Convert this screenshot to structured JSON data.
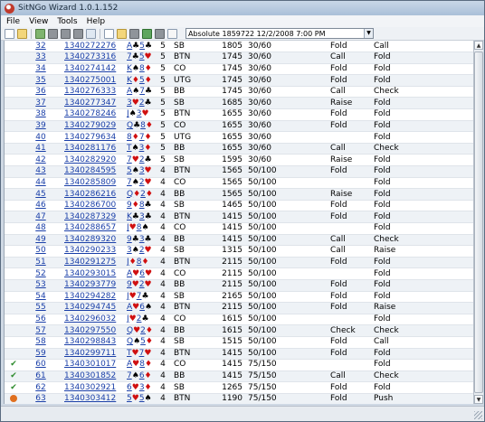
{
  "window": {
    "title": "SitNGo Wizard 1.0.1.152"
  },
  "menu": {
    "file": "File",
    "view": "View",
    "tools": "Tools",
    "help": "Help"
  },
  "toolbar": {
    "session_value": "Absolute 1859722 12/2/2008 7:00 PM"
  },
  "colors": {
    "link": "#1a3fa8",
    "red_suit": "#d01010",
    "status_green": "#2e8b2e",
    "status_orange": "#e07020"
  },
  "rows": [
    {
      "status": "",
      "idx": "32",
      "hand": "1340272276",
      "c1": "A",
      "s1": "♣",
      "c2": "5",
      "s2": "♣",
      "pl": "5",
      "pos": "SB",
      "chips": "1805",
      "blinds": "30/60",
      "a1": "",
      "a2": "Fold",
      "a3": "Call"
    },
    {
      "status": "",
      "idx": "33",
      "hand": "1340273316",
      "c1": "7",
      "s1": "♣",
      "c2": "5",
      "s2": "♥",
      "pl": "5",
      "pos": "BTN",
      "chips": "1745",
      "blinds": "30/60",
      "a1": "",
      "a2": "Call",
      "a3": "Fold"
    },
    {
      "status": "",
      "idx": "34",
      "hand": "1340274142",
      "c1": "K",
      "s1": "♠",
      "c2": "8",
      "s2": "♦",
      "pl": "5",
      "pos": "CO",
      "chips": "1745",
      "blinds": "30/60",
      "a1": "",
      "a2": "Fold",
      "a3": "Fold"
    },
    {
      "status": "",
      "idx": "35",
      "hand": "1340275001",
      "c1": "K",
      "s1": "♦",
      "c2": "5",
      "s2": "♦",
      "pl": "5",
      "pos": "UTG",
      "chips": "1745",
      "blinds": "30/60",
      "a1": "",
      "a2": "Fold",
      "a3": "Fold"
    },
    {
      "status": "",
      "idx": "36",
      "hand": "1340276333",
      "c1": "A",
      "s1": "♠",
      "c2": "7",
      "s2": "♣",
      "pl": "5",
      "pos": "BB",
      "chips": "1745",
      "blinds": "30/60",
      "a1": "",
      "a2": "Call",
      "a3": "Check"
    },
    {
      "status": "",
      "idx": "37",
      "hand": "1340277347",
      "c1": "3",
      "s1": "♥",
      "c2": "2",
      "s2": "♣",
      "pl": "5",
      "pos": "SB",
      "chips": "1685",
      "blinds": "30/60",
      "a1": "",
      "a2": "Raise",
      "a3": "Fold"
    },
    {
      "status": "",
      "idx": "38",
      "hand": "1340278246",
      "c1": "J",
      "s1": "♠",
      "c2": "3",
      "s2": "♥",
      "pl": "5",
      "pos": "BTN",
      "chips": "1655",
      "blinds": "30/60",
      "a1": "",
      "a2": "Fold",
      "a3": "Fold"
    },
    {
      "status": "",
      "idx": "39",
      "hand": "1340279029",
      "c1": "Q",
      "s1": "♣",
      "c2": "8",
      "s2": "♦",
      "pl": "5",
      "pos": "CO",
      "chips": "1655",
      "blinds": "30/60",
      "a1": "",
      "a2": "Fold",
      "a3": "Fold"
    },
    {
      "status": "",
      "idx": "40",
      "hand": "1340279634",
      "c1": "8",
      "s1": "♦",
      "c2": "7",
      "s2": "♦",
      "pl": "5",
      "pos": "UTG",
      "chips": "1655",
      "blinds": "30/60",
      "a1": "",
      "a2": "",
      "a3": "Fold"
    },
    {
      "status": "",
      "idx": "41",
      "hand": "1340281176",
      "c1": "T",
      "s1": "♠",
      "c2": "3",
      "s2": "♦",
      "pl": "5",
      "pos": "BB",
      "chips": "1655",
      "blinds": "30/60",
      "a1": "",
      "a2": "Call",
      "a3": "Check"
    },
    {
      "status": "",
      "idx": "42",
      "hand": "1340282920",
      "c1": "7",
      "s1": "♥",
      "c2": "2",
      "s2": "♣",
      "pl": "5",
      "pos": "SB",
      "chips": "1595",
      "blinds": "30/60",
      "a1": "",
      "a2": "Raise",
      "a3": "Fold"
    },
    {
      "status": "",
      "idx": "43",
      "hand": "1340284595",
      "c1": "5",
      "s1": "♠",
      "c2": "3",
      "s2": "♥",
      "pl": "4",
      "pos": "BTN",
      "chips": "1565",
      "blinds": "50/100",
      "a1": "",
      "a2": "Fold",
      "a3": "Fold"
    },
    {
      "status": "",
      "idx": "44",
      "hand": "1340285809",
      "c1": "7",
      "s1": "♠",
      "c2": "2",
      "s2": "♥",
      "pl": "4",
      "pos": "CO",
      "chips": "1565",
      "blinds": "50/100",
      "a1": "",
      "a2": "",
      "a3": "Fold"
    },
    {
      "status": "",
      "idx": "45",
      "hand": "1340286216",
      "c1": "Q",
      "s1": "♦",
      "c2": "2",
      "s2": "♦",
      "pl": "4",
      "pos": "BB",
      "chips": "1565",
      "blinds": "50/100",
      "a1": "",
      "a2": "Raise",
      "a3": "Fold"
    },
    {
      "status": "",
      "idx": "46",
      "hand": "1340286700",
      "c1": "9",
      "s1": "♦",
      "c2": "8",
      "s2": "♣",
      "pl": "4",
      "pos": "SB",
      "chips": "1465",
      "blinds": "50/100",
      "a1": "",
      "a2": "Fold",
      "a3": "Fold"
    },
    {
      "status": "",
      "idx": "47",
      "hand": "1340287329",
      "c1": "K",
      "s1": "♣",
      "c2": "3",
      "s2": "♣",
      "pl": "4",
      "pos": "BTN",
      "chips": "1415",
      "blinds": "50/100",
      "a1": "",
      "a2": "Fold",
      "a3": "Fold"
    },
    {
      "status": "",
      "idx": "48",
      "hand": "1340288657",
      "c1": "J",
      "s1": "♥",
      "c2": "8",
      "s2": "♠",
      "pl": "4",
      "pos": "CO",
      "chips": "1415",
      "blinds": "50/100",
      "a1": "",
      "a2": "",
      "a3": "Fold"
    },
    {
      "status": "",
      "idx": "49",
      "hand": "1340289320",
      "c1": "9",
      "s1": "♣",
      "c2": "3",
      "s2": "♣",
      "pl": "4",
      "pos": "BB",
      "chips": "1415",
      "blinds": "50/100",
      "a1": "",
      "a2": "Call",
      "a3": "Check"
    },
    {
      "status": "",
      "idx": "50",
      "hand": "1340290233",
      "c1": "3",
      "s1": "♠",
      "c2": "2",
      "s2": "♥",
      "pl": "4",
      "pos": "SB",
      "chips": "1315",
      "blinds": "50/100",
      "a1": "",
      "a2": "Call",
      "a3": "Raise"
    },
    {
      "status": "",
      "idx": "51",
      "hand": "1340291275",
      "c1": "J",
      "s1": "♦",
      "c2": "8",
      "s2": "♦",
      "pl": "4",
      "pos": "BTN",
      "chips": "2115",
      "blinds": "50/100",
      "a1": "",
      "a2": "Fold",
      "a3": "Fold"
    },
    {
      "status": "",
      "idx": "52",
      "hand": "1340293015",
      "c1": "A",
      "s1": "♥",
      "c2": "6",
      "s2": "♥",
      "pl": "4",
      "pos": "CO",
      "chips": "2115",
      "blinds": "50/100",
      "a1": "",
      "a2": "",
      "a3": "Fold"
    },
    {
      "status": "",
      "idx": "53",
      "hand": "1340293779",
      "c1": "9",
      "s1": "♥",
      "c2": "2",
      "s2": "♥",
      "pl": "4",
      "pos": "BB",
      "chips": "2115",
      "blinds": "50/100",
      "a1": "",
      "a2": "Fold",
      "a3": "Fold"
    },
    {
      "status": "",
      "idx": "54",
      "hand": "1340294282",
      "c1": "J",
      "s1": "♥",
      "c2": "7",
      "s2": "♣",
      "pl": "4",
      "pos": "SB",
      "chips": "2165",
      "blinds": "50/100",
      "a1": "",
      "a2": "Fold",
      "a3": "Fold"
    },
    {
      "status": "",
      "idx": "55",
      "hand": "1340294745",
      "c1": "A",
      "s1": "♥",
      "c2": "6",
      "s2": "♠",
      "pl": "4",
      "pos": "BTN",
      "chips": "2115",
      "blinds": "50/100",
      "a1": "",
      "a2": "Fold",
      "a3": "Raise"
    },
    {
      "status": "",
      "idx": "56",
      "hand": "1340296032",
      "c1": "J",
      "s1": "♥",
      "c2": "2",
      "s2": "♣",
      "pl": "4",
      "pos": "CO",
      "chips": "1615",
      "blinds": "50/100",
      "a1": "",
      "a2": "",
      "a3": "Fold"
    },
    {
      "status": "",
      "idx": "57",
      "hand": "1340297550",
      "c1": "Q",
      "s1": "♥",
      "c2": "2",
      "s2": "♦",
      "pl": "4",
      "pos": "BB",
      "chips": "1615",
      "blinds": "50/100",
      "a1": "",
      "a2": "Check",
      "a3": "Check"
    },
    {
      "status": "",
      "idx": "58",
      "hand": "1340298843",
      "c1": "Q",
      "s1": "♠",
      "c2": "5",
      "s2": "♦",
      "pl": "4",
      "pos": "SB",
      "chips": "1515",
      "blinds": "50/100",
      "a1": "",
      "a2": "Fold",
      "a3": "Call"
    },
    {
      "status": "",
      "idx": "59",
      "hand": "1340299711",
      "c1": "T",
      "s1": "♥",
      "c2": "7",
      "s2": "♥",
      "pl": "4",
      "pos": "BTN",
      "chips": "1415",
      "blinds": "50/100",
      "a1": "",
      "a2": "Fold",
      "a3": "Fold"
    },
    {
      "status": "ok",
      "idx": "60",
      "hand": "1340301017",
      "c1": "A",
      "s1": "♥",
      "c2": "8",
      "s2": "♦",
      "pl": "4",
      "pos": "CO",
      "chips": "1415",
      "blinds": "75/150",
      "a1": "",
      "a2": "",
      "a3": "Fold"
    },
    {
      "status": "ok",
      "idx": "61",
      "hand": "1340301852",
      "c1": "7",
      "s1": "♠",
      "c2": "6",
      "s2": "♦",
      "pl": "4",
      "pos": "BB",
      "chips": "1415",
      "blinds": "75/150",
      "a1": "",
      "a2": "Call",
      "a3": "Check"
    },
    {
      "status": "ok",
      "idx": "62",
      "hand": "1340302921",
      "c1": "6",
      "s1": "♥",
      "c2": "3",
      "s2": "♦",
      "pl": "4",
      "pos": "SB",
      "chips": "1265",
      "blinds": "75/150",
      "a1": "",
      "a2": "Fold",
      "a3": "Fold"
    },
    {
      "status": "fire",
      "idx": "63",
      "hand": "1340303412",
      "c1": "5",
      "s1": "♥",
      "c2": "5",
      "s2": "♠",
      "pl": "4",
      "pos": "BTN",
      "chips": "1190",
      "blinds": "75/150",
      "a1": "",
      "a2": "Fold",
      "a3": "Push"
    }
  ]
}
